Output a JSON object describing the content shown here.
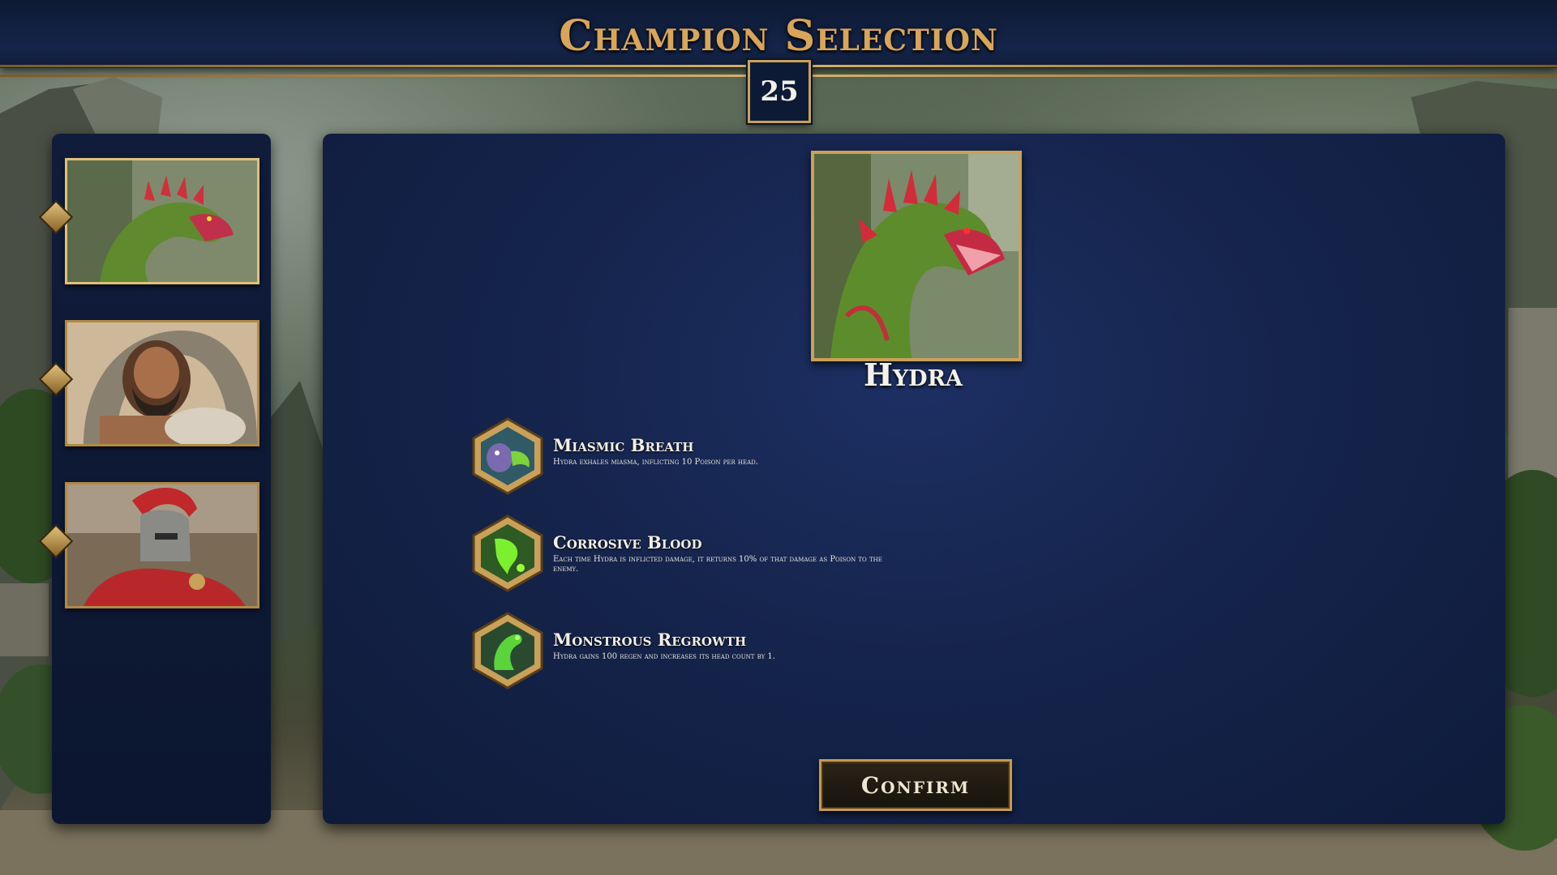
{
  "header": {
    "title": "Champion Selection",
    "timer": "25"
  },
  "roster": {
    "cards": [
      {
        "id": "hydra",
        "portrait": "hydra-portrait",
        "selected": true
      },
      {
        "id": "bearded-hero",
        "portrait": "bearded-hero-portrait",
        "selected": false
      },
      {
        "id": "spartan",
        "portrait": "spartan-portrait",
        "selected": false
      }
    ]
  },
  "champion": {
    "name": "Hydra",
    "portrait": "hydra-portrait"
  },
  "abilities": [
    {
      "name": "Miasmic Breath",
      "description": "Hydra exhales miasma, inflicting 10 Poison per head.",
      "icon": "breath-icon"
    },
    {
      "name": "Corrosive Blood",
      "description": "Each time Hydra is inflicted damage, it returns 10% of that damage as Poison to the enemy.",
      "icon": "blood-icon"
    },
    {
      "name": "Monstrous Regrowth",
      "description": "Hydra gains 100 regen and increases its head count by 1.",
      "icon": "regrowth-icon"
    }
  ],
  "actions": {
    "confirm_label": "Confirm"
  },
  "colors": {
    "gold": "#c9a15a",
    "panel": "#15244c",
    "title": "#d8a55a"
  }
}
